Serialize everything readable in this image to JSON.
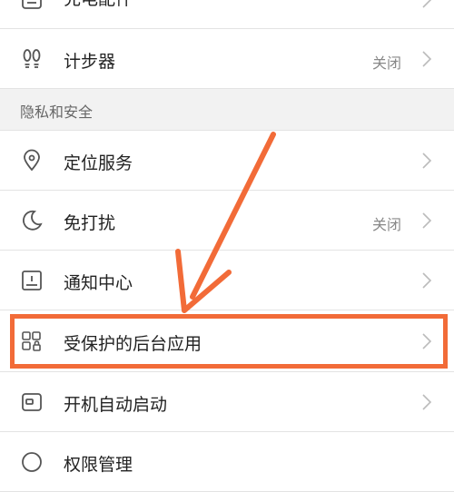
{
  "rows": {
    "charge_accessory": {
      "label": "充电配件",
      "icon": "charger-icon"
    },
    "pedometer": {
      "label": "计步器",
      "value": "关闭",
      "icon": "footprints-icon"
    },
    "location": {
      "label": "定位服务",
      "icon": "location-pin-icon"
    },
    "do_not_disturb": {
      "label": "免打扰",
      "value": "关闭",
      "icon": "moon-icon"
    },
    "notification_center": {
      "label": "通知中心",
      "icon": "notification-center-icon"
    },
    "protected_background_apps": {
      "label": "受保护的后台应用",
      "icon": "protected-apps-icon"
    },
    "auto_start": {
      "label": "开机自动启动",
      "icon": "power-on-icon"
    },
    "permission_management": {
      "label": "权限管理",
      "icon": "permission-icon"
    }
  },
  "section": {
    "privacy_security": "隐私和安全"
  },
  "annotation": {
    "arrow_color": "#f26b38",
    "highlight_color": "#f26b38"
  }
}
